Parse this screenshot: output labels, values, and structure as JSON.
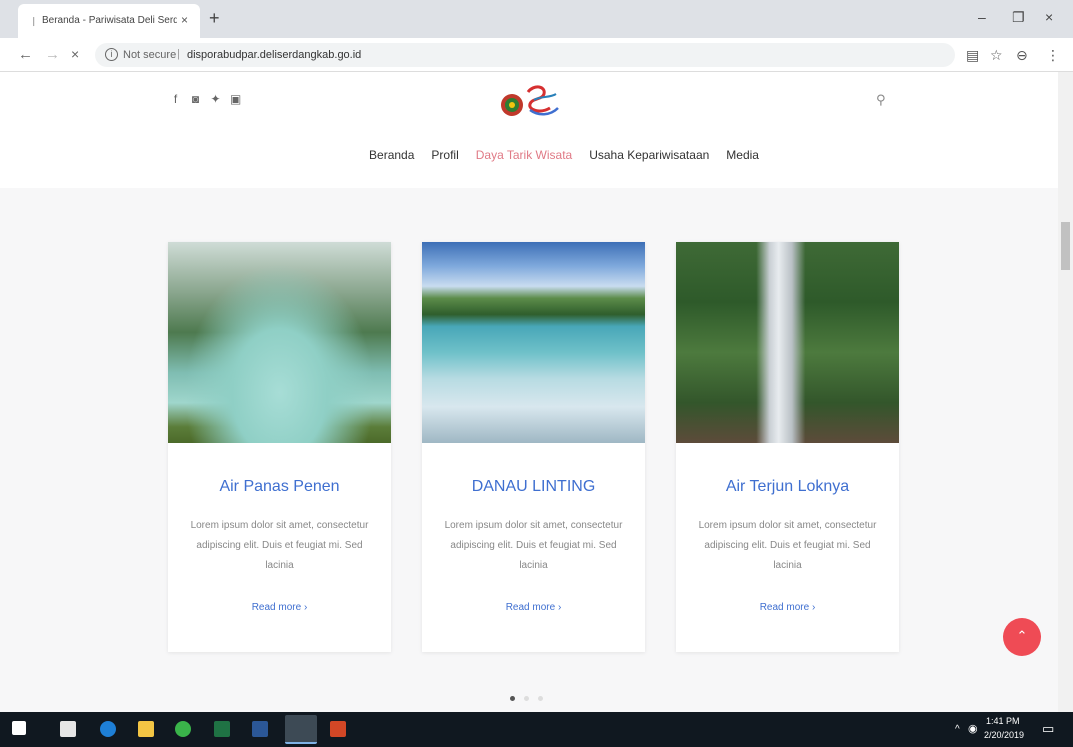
{
  "browser": {
    "tab_title": "Beranda - Pariwisata Deli Serdang",
    "new_tab": "+",
    "not_secure": "Not secure",
    "separator": "|",
    "url": "disporabudpar.deliserdangkab.go.id"
  },
  "header": {
    "social_icons": [
      "facebook-icon",
      "instagram-icon",
      "twitter-icon",
      "youtube-icon"
    ],
    "logo_icon": "deli-serdang-logo",
    "menu": [
      {
        "label": "Beranda",
        "active": false
      },
      {
        "label": "Profil",
        "active": false
      },
      {
        "label": "Daya Tarik Wisata",
        "active": true
      },
      {
        "label": "Usaha Kepariwisataan",
        "active": false
      },
      {
        "label": "Media",
        "active": false
      }
    ]
  },
  "cards": [
    {
      "title": "Air Panas Penen",
      "text": "Lorem ipsum dolor sit amet, consectetur adipiscing elit. Duis et feugiat mi. Sed lacinia",
      "read_more": "Read more"
    },
    {
      "title": "DANAU LINTING",
      "text": "Lorem ipsum dolor sit amet, consectetur adipiscing elit. Duis et feugiat mi. Sed lacinia",
      "read_more": "Read more"
    },
    {
      "title": "Air Terjun Loknya",
      "text": "Lorem ipsum dolor sit amet, consectetur adipiscing elit. Duis et feugiat mi. Sed lacinia",
      "read_more": "Read more"
    }
  ],
  "carousel": {
    "active_index": 0,
    "count": 3
  },
  "taskbar": {
    "time": "1:41 PM",
    "date": "2/20/2019"
  },
  "colors": {
    "accent": "#3f6fd0",
    "menu_active": "#e07a86",
    "scroll_top": "#ef4b55",
    "taskbar": "#101820"
  }
}
